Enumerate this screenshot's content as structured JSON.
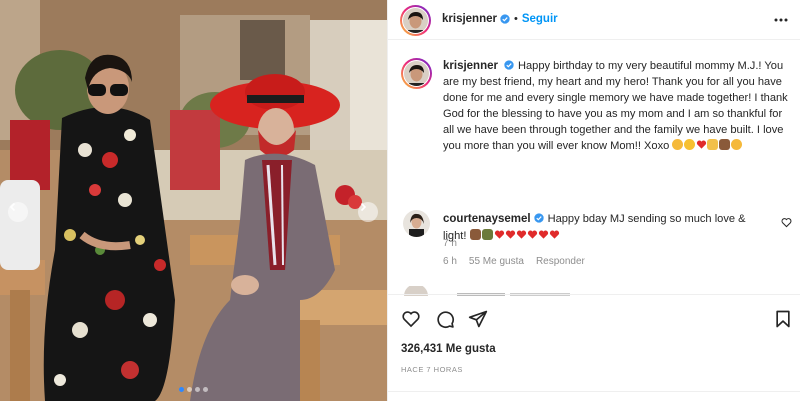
{
  "post": {
    "username": "krisjenner",
    "follow_label": "Seguir",
    "more_icon": "more-horizontal-icon",
    "verified_icon": "verified-badge-icon"
  },
  "caption": {
    "username": "krisjenner",
    "text": "Happy birthday to my very beautiful mommy M.J.! You are my best friend, my heart and my hero! Thank you for all you have done for me and every single memory we have made together! I thank God for the blessing to have you as my mom and I am so thankful for all we have been through together and the family we have built. I love you more than you will ever know Mom!! Xoxo",
    "emojis": [
      "smiling-face-hearts",
      "star-struck",
      "red-heart",
      "folded-hands",
      "cake",
      "smiling-face-hearts"
    ],
    "time_ago": "7 h"
  },
  "comments": [
    {
      "username": "courtenaysemel",
      "text": "Happy bday MJ sending so much love & light!",
      "emojis": [
        "cake",
        "cake",
        "red-heart",
        "red-heart",
        "red-heart",
        "red-heart",
        "red-heart",
        "red-heart"
      ],
      "time": "6 h",
      "likes": "55 Me gusta",
      "reply_label": "Responder"
    }
  ],
  "actions": {
    "like_icon": "heart-icon",
    "comment_icon": "comment-icon",
    "share_icon": "paper-plane-icon",
    "save_icon": "bookmark-icon"
  },
  "likes_count": "326,431 Me gusta",
  "posted_ago": "HACE 7 HORAS",
  "carousel": {
    "total": 4,
    "active": 0
  },
  "colors": {
    "accent": "#0095f6",
    "text": "#262626",
    "muted": "#8e8e8e",
    "heart_red": "#ed4956"
  }
}
